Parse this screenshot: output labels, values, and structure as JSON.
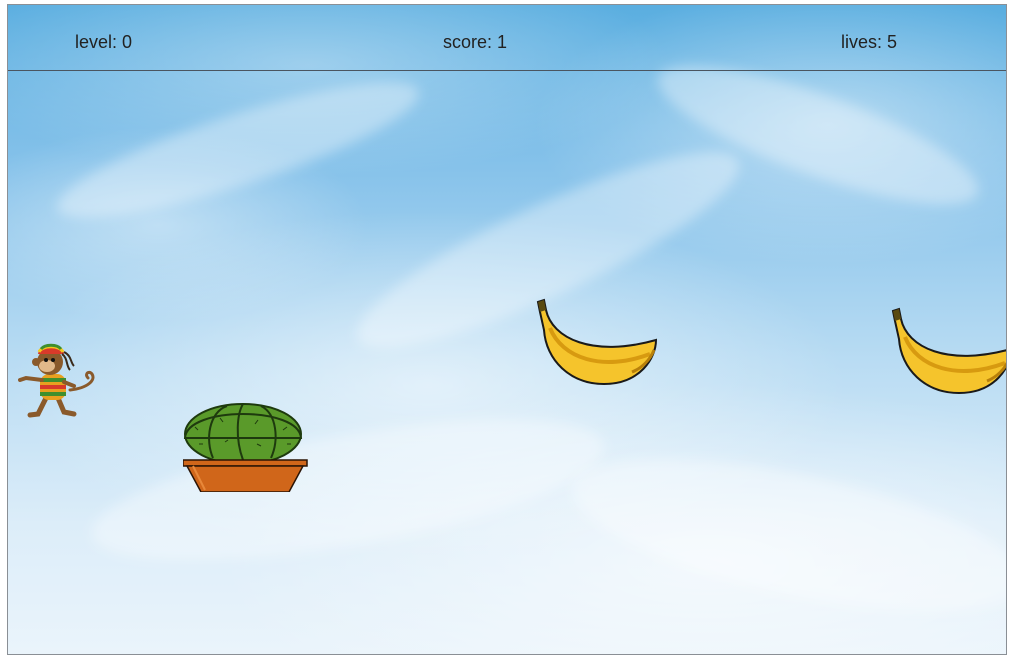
{
  "hud": {
    "level_label": "level: 0",
    "score_label": "score: 1",
    "lives_label": "lives: 5"
  },
  "colors": {
    "sky_top": "#5aaee0",
    "sky_bottom": "#eaf4fb",
    "banana_yellow": "#f5c42c",
    "cactus_green": "#5a9a2a",
    "pot_orange": "#d0661a"
  },
  "sprites": {
    "player": "monkey-icon",
    "obstacle": "cactus-pot-icon",
    "collectible": "banana-icon"
  }
}
